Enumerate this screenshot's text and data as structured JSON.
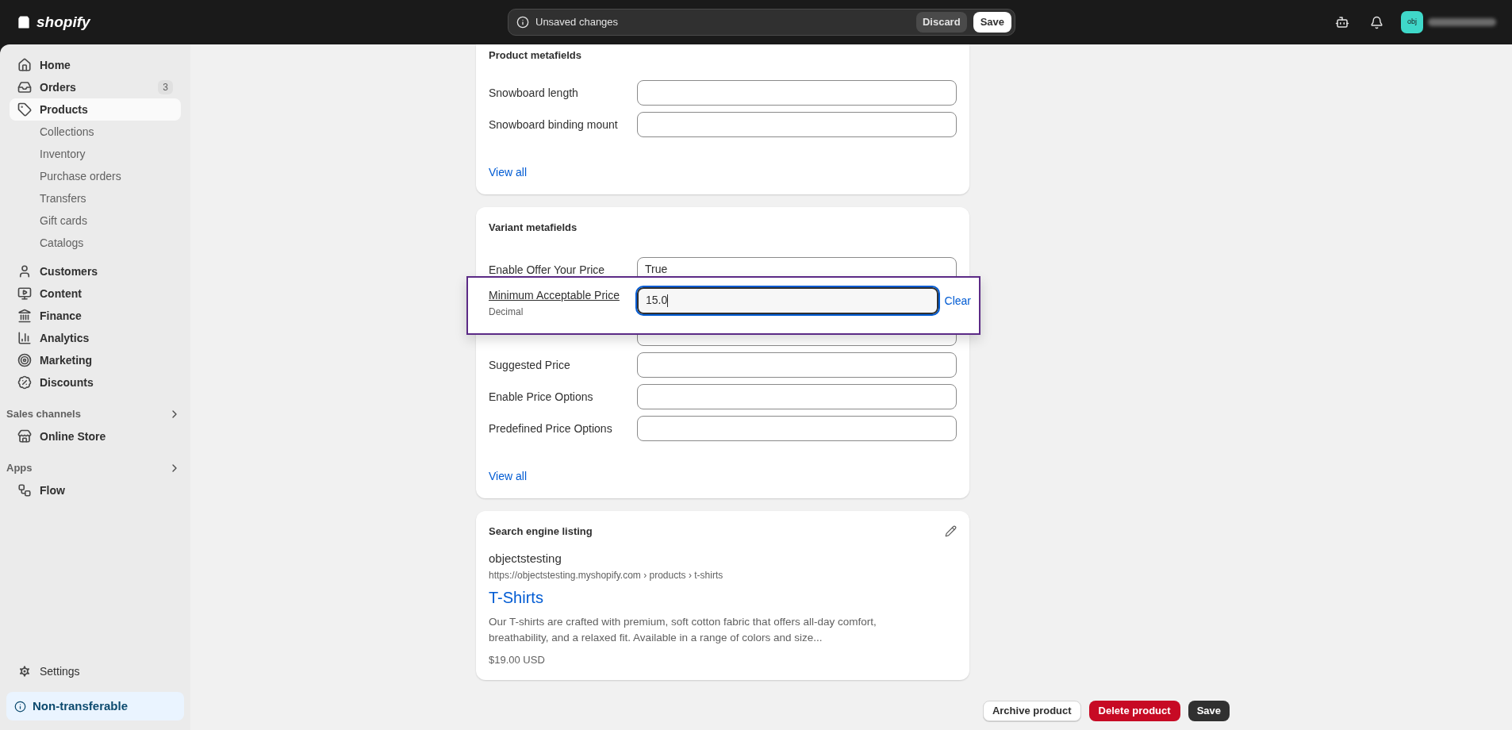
{
  "top_bar": {
    "logo": "shopify",
    "notice": "Unsaved changes",
    "discard": "Discard",
    "save": "Save",
    "avatar": "obj"
  },
  "sidebar": {
    "items": [
      {
        "label": "Home",
        "selected": false
      },
      {
        "label": "Orders",
        "selected": false,
        "badge": "3"
      },
      {
        "label": "Products",
        "selected": true,
        "children": [
          {
            "label": "Collections"
          },
          {
            "label": "Inventory"
          },
          {
            "label": "Purchase orders"
          },
          {
            "label": "Transfers"
          },
          {
            "label": "Gift cards"
          },
          {
            "label": "Catalogs"
          }
        ]
      },
      {
        "label": "Customers",
        "selected": false
      },
      {
        "label": "Content",
        "selected": false
      },
      {
        "label": "Finance",
        "selected": false
      },
      {
        "label": "Analytics",
        "selected": false
      },
      {
        "label": "Marketing",
        "selected": false
      },
      {
        "label": "Discounts",
        "selected": false
      }
    ],
    "sections": [
      {
        "title": "Sales channels",
        "items": [
          {
            "label": "Online Store"
          }
        ]
      },
      {
        "title": "Apps",
        "items": [
          {
            "label": "Flow"
          }
        ]
      }
    ],
    "settings": "Settings",
    "notice": "Non-transferable"
  },
  "product_metafields": {
    "title": "Product metafields",
    "fields": [
      {
        "label": "Snowboard length"
      },
      {
        "label": "Snowboard binding mount"
      }
    ],
    "link": "View all"
  },
  "variant_metafields": {
    "title": "Variant metafields",
    "fields": [
      {
        "kind": "field",
        "label": "Enable Offer Your Price",
        "value": "True"
      },
      {
        "kind": "editing",
        "label": "Minimum Acceptable Price",
        "type": "Decimal",
        "value": "15.0",
        "action": "Clear"
      },
      {
        "kind": "covered"
      },
      {
        "kind": "field",
        "label": "Suggested Price"
      },
      {
        "kind": "field",
        "label": "Enable Price Options"
      },
      {
        "kind": "field",
        "label": "Predefined Price Options"
      }
    ],
    "link": "View all"
  },
  "search_engine_listing": {
    "title": "Search engine listing",
    "store": "objectstesting",
    "url": "https://objectstesting.myshopify.com › products › t-shirts",
    "page_title": "T-Shirts",
    "description": "Our T-shirts are crafted with premium, soft cotton fabric that offers all-day comfort, breathability, and a relaxed fit. Available in a range of colors and size...",
    "price": "$19.00 USD"
  },
  "actions": {
    "archive": "Archive product",
    "delete": "Delete product",
    "save": "Save"
  }
}
